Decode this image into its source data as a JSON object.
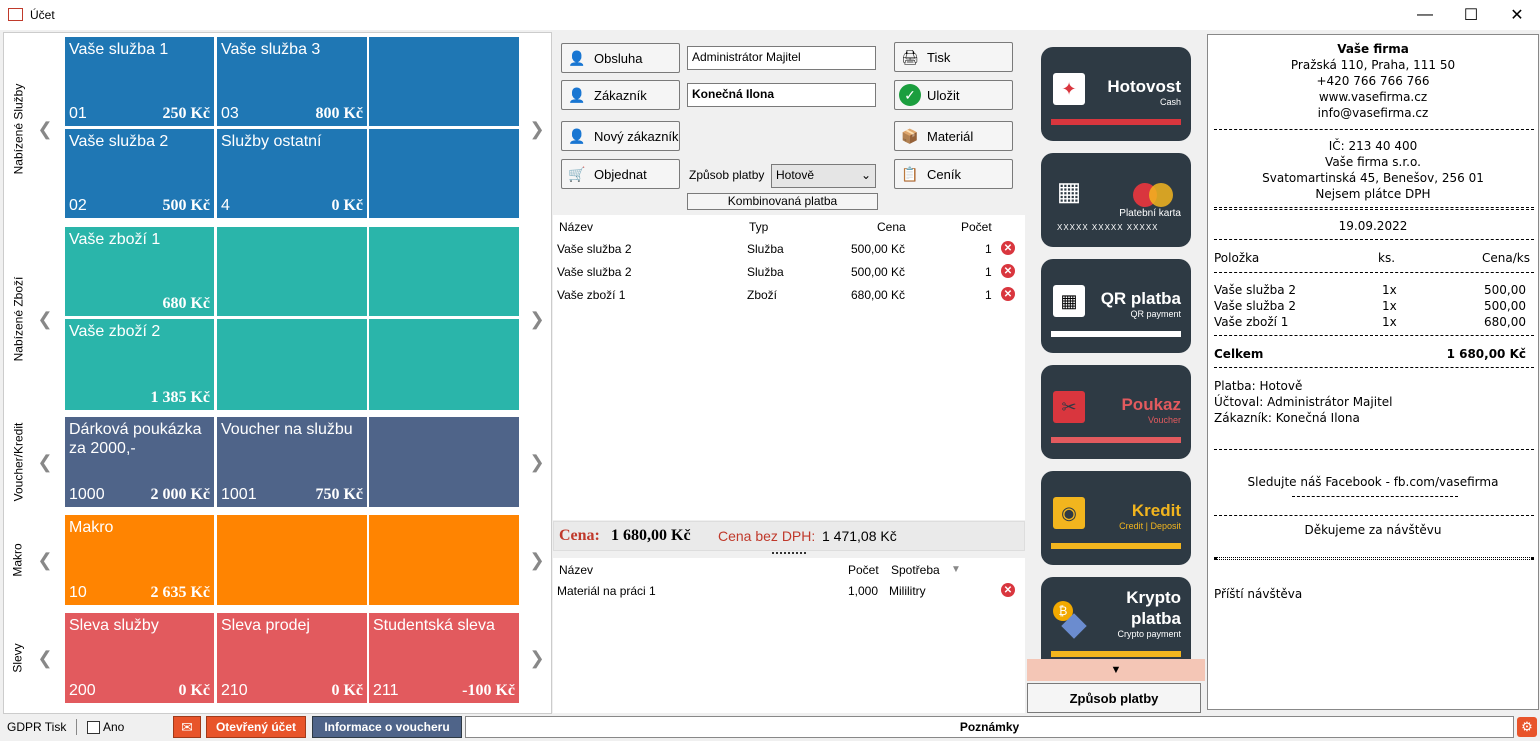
{
  "window": {
    "title": "Účet"
  },
  "left": {
    "rows": [
      {
        "label": "Nabízené Služby"
      },
      {
        "label": "Nabízené Zboží"
      },
      {
        "label": "Voucher/Kredit"
      },
      {
        "label": "Makro"
      },
      {
        "label": "Slevy"
      }
    ],
    "tiles": [
      {
        "name": "Vaše služba 1",
        "code": "01",
        "price": "250 Kč"
      },
      {
        "name": "Vaše služba 3",
        "code": "03",
        "price": "800 Kč"
      },
      {
        "name": "Vaše služba 2",
        "code": "02",
        "price": "500 Kč"
      },
      {
        "name": "Služby ostatní",
        "code": "4",
        "price": "0 Kč"
      },
      {
        "name": "Vaše zboží 1",
        "code": "",
        "price": "680 Kč"
      },
      {
        "name": "Vaše zboží 2",
        "code": "",
        "price": "1 385 Kč"
      },
      {
        "name": "Dárková poukázka za 2000,-",
        "code": "1000",
        "price": "2 000 Kč"
      },
      {
        "name": "Voucher na službu",
        "code": "1001",
        "price": "750 Kč"
      },
      {
        "name": "Makro",
        "code": "10",
        "price": "2 635 Kč"
      },
      {
        "name": "Sleva služby",
        "code": "200",
        "price": "0 Kč"
      },
      {
        "name": "Sleva prodej",
        "code": "210",
        "price": "0 Kč"
      },
      {
        "name": "Studentská sleva",
        "code": "211",
        "price": "-100 Kč"
      }
    ]
  },
  "controls": {
    "obsluha": "Obsluha",
    "obsluha_value": "Administrátor Majitel",
    "zakaznik": "Zákazník",
    "zakaznik_value": "Konečná Ilona",
    "novy_zakaznik": "Nový zákazník",
    "objednat": "Objednat",
    "zpusob_platby_label": "Způsob platby",
    "zpusob_platby_value": "Hotově",
    "kombinovana": "Kombinovaná platba",
    "tisk": "Tisk",
    "ulozit": "Uložit",
    "material": "Materiál",
    "cenik": "Ceník"
  },
  "items_table": {
    "headers": [
      "Název",
      "Typ",
      "Cena",
      "Počet"
    ],
    "rows": [
      {
        "name": "Vaše služba 2",
        "type": "Služba",
        "price": "500,00 Kč",
        "qty": "1"
      },
      {
        "name": "Vaše služba 2",
        "type": "Služba",
        "price": "500,00 Kč",
        "qty": "1"
      },
      {
        "name": "Vaše zboží 1",
        "type": "Zboží",
        "price": "680,00 Kč",
        "qty": "1"
      }
    ]
  },
  "totals": {
    "cena_label": "Cena:",
    "cena_value": "1 680,00 Kč",
    "bez_dph_label": "Cena bez DPH:",
    "bez_dph_value": "1 471,08 Kč"
  },
  "material_table": {
    "headers": [
      "Název",
      "Počet",
      "Spotřeba"
    ],
    "rows": [
      {
        "name": "Materiál na práci 1",
        "qty": "1,000",
        "unit": "Mililitry"
      }
    ]
  },
  "payments": [
    {
      "label": "Hotovost",
      "sub": "Cash",
      "color": "#d9363e"
    },
    {
      "label": "",
      "sub": "Platební karta",
      "extra": "XXXXX  XXXXX  XXXXX",
      "color": "#ffffff"
    },
    {
      "label": "QR platba",
      "sub": "QR payment",
      "color": "#ffffff"
    },
    {
      "label": "Poukaz",
      "sub": "Voucher",
      "color": "#e25a5e"
    },
    {
      "label": "Kredit",
      "sub": "Credit | Deposit",
      "color": "#f2b51e"
    },
    {
      "label": "Krypto platba",
      "sub": "Crypto payment",
      "color": "#f2b51e"
    }
  ],
  "payment_method_button": "Způsob platby",
  "receipt": {
    "company": "Vaše firma",
    "address": "Pražská 110, Praha, 111 50",
    "phone": "+420 766 766 766",
    "web": "www.vasefirma.cz",
    "email": "info@vasefirma.cz",
    "ic": "IČ: 213 40 400",
    "company2": "Vaše firma s.r.o.",
    "address2": "Svatomartinská 45, Benešov, 256 01",
    "dph": "Nejsem plátce DPH",
    "date": "19.09.2022",
    "col_item": "Položka",
    "col_qty": "ks.",
    "col_price": "Cena/ks",
    "lines": [
      {
        "name": "Vaše služba 2",
        "qty": "1x",
        "price": "500,00"
      },
      {
        "name": "Vaše služba 2",
        "qty": "1x",
        "price": "500,00"
      },
      {
        "name": "Vaše zboží 1",
        "qty": "1x",
        "price": "680,00"
      }
    ],
    "total_label": "Celkem",
    "total_value": "1 680,00 Kč",
    "platba": "Platba: Hotově",
    "uctoval": "Účtoval: Administrátor Majitel",
    "zakaznik": "Zákazník: Konečná Ilona",
    "facebook": "Sledujte náš Facebook - fb.com/vasefirma",
    "thanks": "Děkujeme za návštěvu",
    "next": "Příští návštěva"
  },
  "statusbar": {
    "gdpr": "GDPR Tisk",
    "ano": "Ano",
    "open_account": "Otevřený účet",
    "voucher_info": "Informace o voucheru",
    "notes": "Poznámky"
  }
}
